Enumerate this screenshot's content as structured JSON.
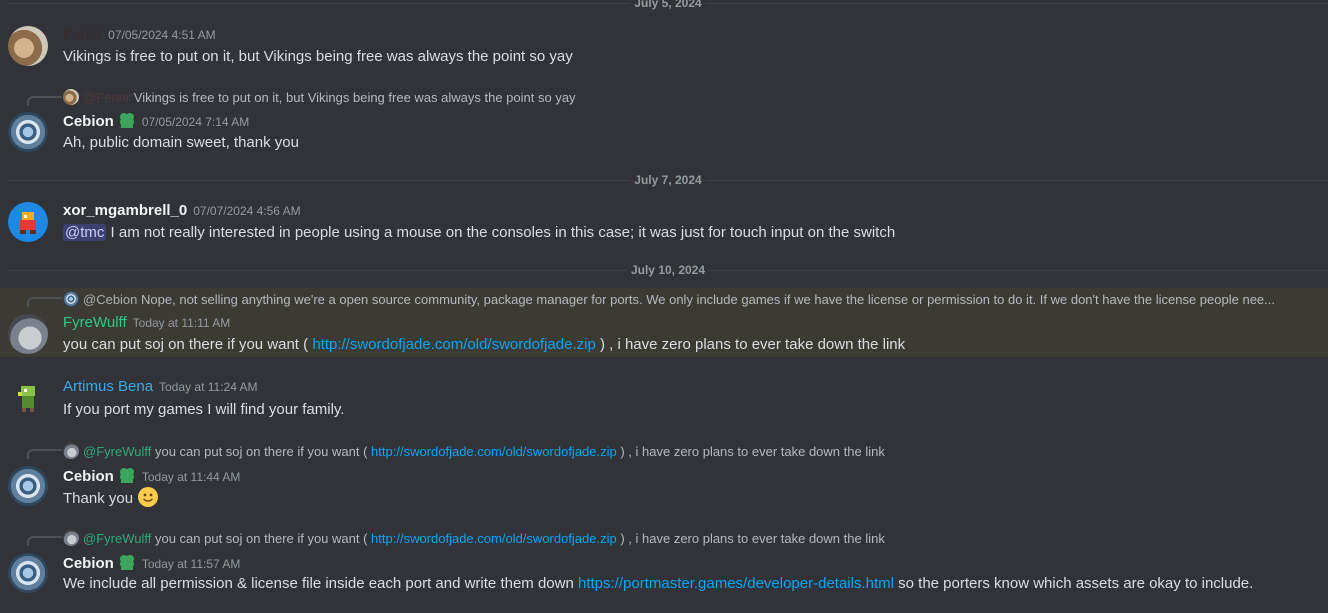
{
  "dividers": [
    "July 5, 2024",
    "July 7, 2024",
    "July 10, 2024"
  ],
  "colors": {
    "background": "#313338",
    "fenrir": "#3a2a2a",
    "cebion": "#f2f3f5",
    "xor": "#f2f3f5",
    "fyrewulff": "#2dc98a",
    "artimus": "#3aa8e8",
    "link": "#00a8fc",
    "highlight": "#3b3a33"
  },
  "messages": [
    {
      "author": "Fenrir",
      "time": "07/05/2024 4:51 AM",
      "text": "Vikings is free to put on it, but Vikings being free was always the point so yay"
    },
    {
      "reply": {
        "name": "@Fenrir",
        "text": "Vikings is free to put on it, but Vikings being free was always the point so yay"
      },
      "author": "Cebion",
      "time": "07/05/2024 7:14 AM",
      "text": "Ah, public domain sweet, thank you"
    },
    {
      "author": "xor_mgambrell_0",
      "time": "07/07/2024 4:56 AM",
      "mention": "@tmc",
      "text": " I am not really interested in people using a mouse on the consoles in this case; it was just for touch input on the switch"
    },
    {
      "reply": {
        "name": "@Cebion",
        "text": "Nope, not selling anything we're a open source community, package manager for ports. We only include games if we have the license or permission to do it. If we don't have the license people nee..."
      },
      "author": "FyreWulff",
      "time": "Today at 11:11 AM",
      "text_before": "you can put soj on there if you want ( ",
      "link": "http://swordofjade.com/old/swordofjade.zip",
      "text_after": " ) , i have zero plans to ever take down the link"
    },
    {
      "author": "Artimus Bena",
      "time": "Today at 11:24 AM",
      "text": "If you port my games I will find your family."
    },
    {
      "reply": {
        "name": "@FyreWulff",
        "text_before": "you can put soj on there if you want ( ",
        "link": "http://swordofjade.com/old/swordofjade.zip",
        "text_after": " ) , i have zero plans to ever take down the link"
      },
      "author": "Cebion",
      "time": "Today at 11:44 AM",
      "text": "Thank you "
    },
    {
      "reply": {
        "name": "@FyreWulff",
        "text_before": "you can put soj on there if you want ( ",
        "link": "http://swordofjade.com/old/swordofjade.zip",
        "text_after": " ) , i have zero plans to ever take down the link"
      },
      "author": "Cebion",
      "time": "Today at 11:57 AM",
      "text_before": "We include all permission & license file inside each port and write them down ",
      "link": "https://portmaster.games/developer-details.html",
      "text_after": " so the porters know which assets are okay to include."
    }
  ]
}
